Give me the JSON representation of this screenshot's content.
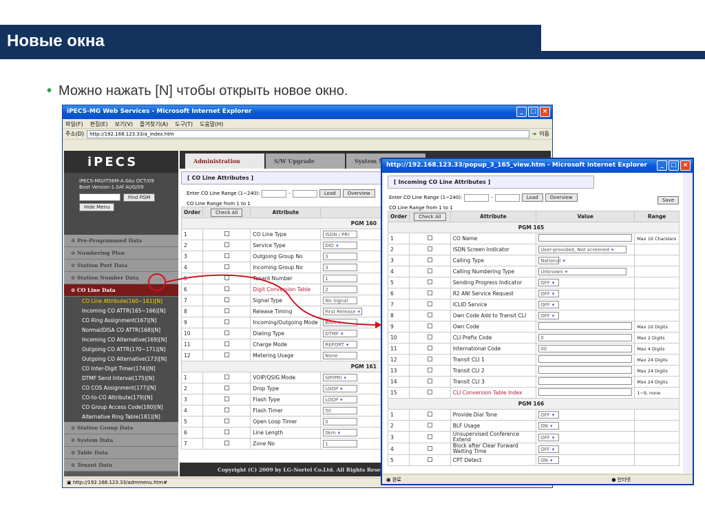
{
  "slide": {
    "title": "Новые окна",
    "bullet": "Можно нажать [N] чтобы открыть новое окно."
  },
  "main_window": {
    "title": "iPECS-MG Web Services - Microsoft Internet Explorer",
    "menu": [
      "파일(F)",
      "편집(E)",
      "보기(V)",
      "즐겨찾기(A)",
      "도구(T)",
      "도움말(H)"
    ],
    "address_label": "주소(D)",
    "address": "http://192.168.123.33/a_index.htm",
    "go_label": "이동",
    "logo": "iPECS",
    "version_lines": [
      "iPECS-MG/IT56M-A.0Au OCT/09",
      "Boot Version-1.0Af AUG/09"
    ],
    "find_pgm": "Find PGM",
    "hide_menu": "Hide Menu",
    "nav_top": [
      "Pre-Programmed Data",
      "Numbering Plan",
      "Station Port Data",
      "Station Number Data",
      "CO Line Data"
    ],
    "nav_sub": [
      "CO Line Attribute(160~161)[N]",
      "Incoming CO ATTR(165~166)[N]",
      "CO Ring Assignment(167)[N]",
      "Normal/DISA CO ATTR(168)[N]",
      "Incoming CO Alternative(169)[N]",
      "Outgoing CO ATTR(170~171)[N]",
      "Outgoing CO Alternative(173)[N]",
      "CO Inter-Digit Timer(174)[N]",
      "DTMF Send Interval(175)[N]",
      "CO COS Assignment(177)[N]",
      "CO-to-CO Attribute(179)[N]",
      "CO Group Access Code(180)[N]",
      "Alternative Ring Table(181)[N]"
    ],
    "nav_bottom": [
      "Station Group Data",
      "System Data",
      "Table Data",
      "Tenant Data"
    ],
    "tabs": [
      "Administration",
      "S/W Upgrade",
      "System M..."
    ],
    "section_title": "[ CO Line Attributes ]",
    "range_label": "Enter CO Line Range (1~240):",
    "load": "Load",
    "overview": "Overview",
    "range_from": "CO Line Range from 1 to 1",
    "col_order": "Order",
    "check_all": "Check All",
    "col_attribute": "Attribute",
    "pgm160": "PGM 160",
    "rows160": [
      {
        "n": "1",
        "attr": "CO Line Type",
        "val": "ISDN / PRI"
      },
      {
        "n": "2",
        "attr": "Service Type",
        "val": "DID"
      },
      {
        "n": "3",
        "attr": "Outgoing Group No",
        "val": "3"
      },
      {
        "n": "4",
        "attr": "Incoming Group No",
        "val": "3"
      },
      {
        "n": "5",
        "attr": "Tenant Number",
        "val": "1"
      },
      {
        "n": "6",
        "attr": "Digit Conversion Table",
        "val": "2"
      },
      {
        "n": "7",
        "attr": "Signal Type",
        "val": "No Signal"
      },
      {
        "n": "8",
        "attr": "Release Timing",
        "val": "First Release"
      },
      {
        "n": "9",
        "attr": "Incoming/Outgoing Mode",
        "val": "Both"
      },
      {
        "n": "10",
        "attr": "Dialing Type",
        "val": "DTMF"
      },
      {
        "n": "11",
        "attr": "Charge Mode",
        "val": "REPORT"
      },
      {
        "n": "12",
        "attr": "Metering Usage",
        "val": "None"
      }
    ],
    "pgm161": "PGM 161",
    "rows161": [
      {
        "n": "1",
        "attr": "VOIP/QSIG Mode",
        "val": "SIP/PRI"
      },
      {
        "n": "2",
        "attr": "Drop Type",
        "val": "LOOP"
      },
      {
        "n": "3",
        "attr": "Flash Type",
        "val": "LOOP"
      },
      {
        "n": "4",
        "attr": "Flash Timer",
        "val": "50"
      },
      {
        "n": "5",
        "attr": "Open Loop Timer",
        "val": "0"
      },
      {
        "n": "6",
        "attr": "Line Length",
        "val": "0km"
      },
      {
        "n": "7",
        "attr": "Zone No",
        "val": "1"
      }
    ],
    "copyright": "Copyright (C) 2009 by LG-Nortel Co.Ltd. All Rights Reserv...",
    "status": "http://192.168.123.33/admmenu.htm#"
  },
  "popup": {
    "title": "http://192.168.123.33/popup_3_165_view.htm - Microsoft Internet Explorer",
    "section_title": "[ Incoming CO Line Attributes ]",
    "range_label": "Enter CO Line Range (1~240):",
    "load": "Load",
    "overview": "Overview",
    "save": "Save",
    "range_from": "CO Line Range from 1 to 1",
    "col_order": "Order",
    "check_all": "Check All",
    "col_attribute": "Attribute",
    "col_value": "Value",
    "col_range": "Range",
    "pgm165": "PGM 165",
    "rows165": [
      {
        "n": "1",
        "attr": "CO Name",
        "val": "",
        "range": "Max 16 Charsters"
      },
      {
        "n": "2",
        "attr": "ISDN Screen Indicator",
        "val": "User-provided, Not screened",
        "range": ""
      },
      {
        "n": "3",
        "attr": "Calling Type",
        "val": "National",
        "range": ""
      },
      {
        "n": "4",
        "attr": "Calling Numbering Type",
        "val": "Unknown",
        "range": ""
      },
      {
        "n": "5",
        "attr": "Sending Progress Indicator",
        "val": "OFF",
        "range": ""
      },
      {
        "n": "6",
        "attr": "R2 ANI Service Request",
        "val": "OFF",
        "range": ""
      },
      {
        "n": "7",
        "attr": "ICLID Service",
        "val": "OFF",
        "range": ""
      },
      {
        "n": "8",
        "attr": "Own Code Add to Transit CLI",
        "val": "OFF",
        "range": ""
      },
      {
        "n": "9",
        "attr": "Own Code",
        "val": "",
        "range": "Max 16 Digits"
      },
      {
        "n": "10",
        "attr": "CLI Prefix Code",
        "val": "0",
        "range": "Max 2 Digits"
      },
      {
        "n": "11",
        "attr": "International Code",
        "val": "00",
        "range": "Max 4 Digits"
      },
      {
        "n": "12",
        "attr": "Transit CLI 1",
        "val": "",
        "range": "Max 24 Digits"
      },
      {
        "n": "13",
        "attr": "Transit CLI 2",
        "val": "",
        "range": "Max 24 Digits"
      },
      {
        "n": "14",
        "attr": "Transit CLI 3",
        "val": "",
        "range": "Max 24 Digits"
      },
      {
        "n": "15",
        "attr": "CLI Conversion Table Index",
        "val": "",
        "range": "1~9, none"
      }
    ],
    "pgm166": "PGM 166",
    "rows166": [
      {
        "n": "1",
        "attr": "Provide Dial Tone",
        "val": "OFF"
      },
      {
        "n": "2",
        "attr": "BLF Usage",
        "val": "ON"
      },
      {
        "n": "3",
        "attr": "Unsupervised Conference Extend",
        "val": "OFF"
      },
      {
        "n": "4",
        "attr": "Block after Clear Forward Waiting Time",
        "val": "OFF"
      },
      {
        "n": "5",
        "attr": "CPT Detect",
        "val": "ON"
      }
    ],
    "status_left": "완료",
    "status_right": "인터넷"
  },
  "colors": {
    "banner": "#13325e",
    "bullet": "#2e9a4a",
    "arrow": "#d4101e"
  }
}
